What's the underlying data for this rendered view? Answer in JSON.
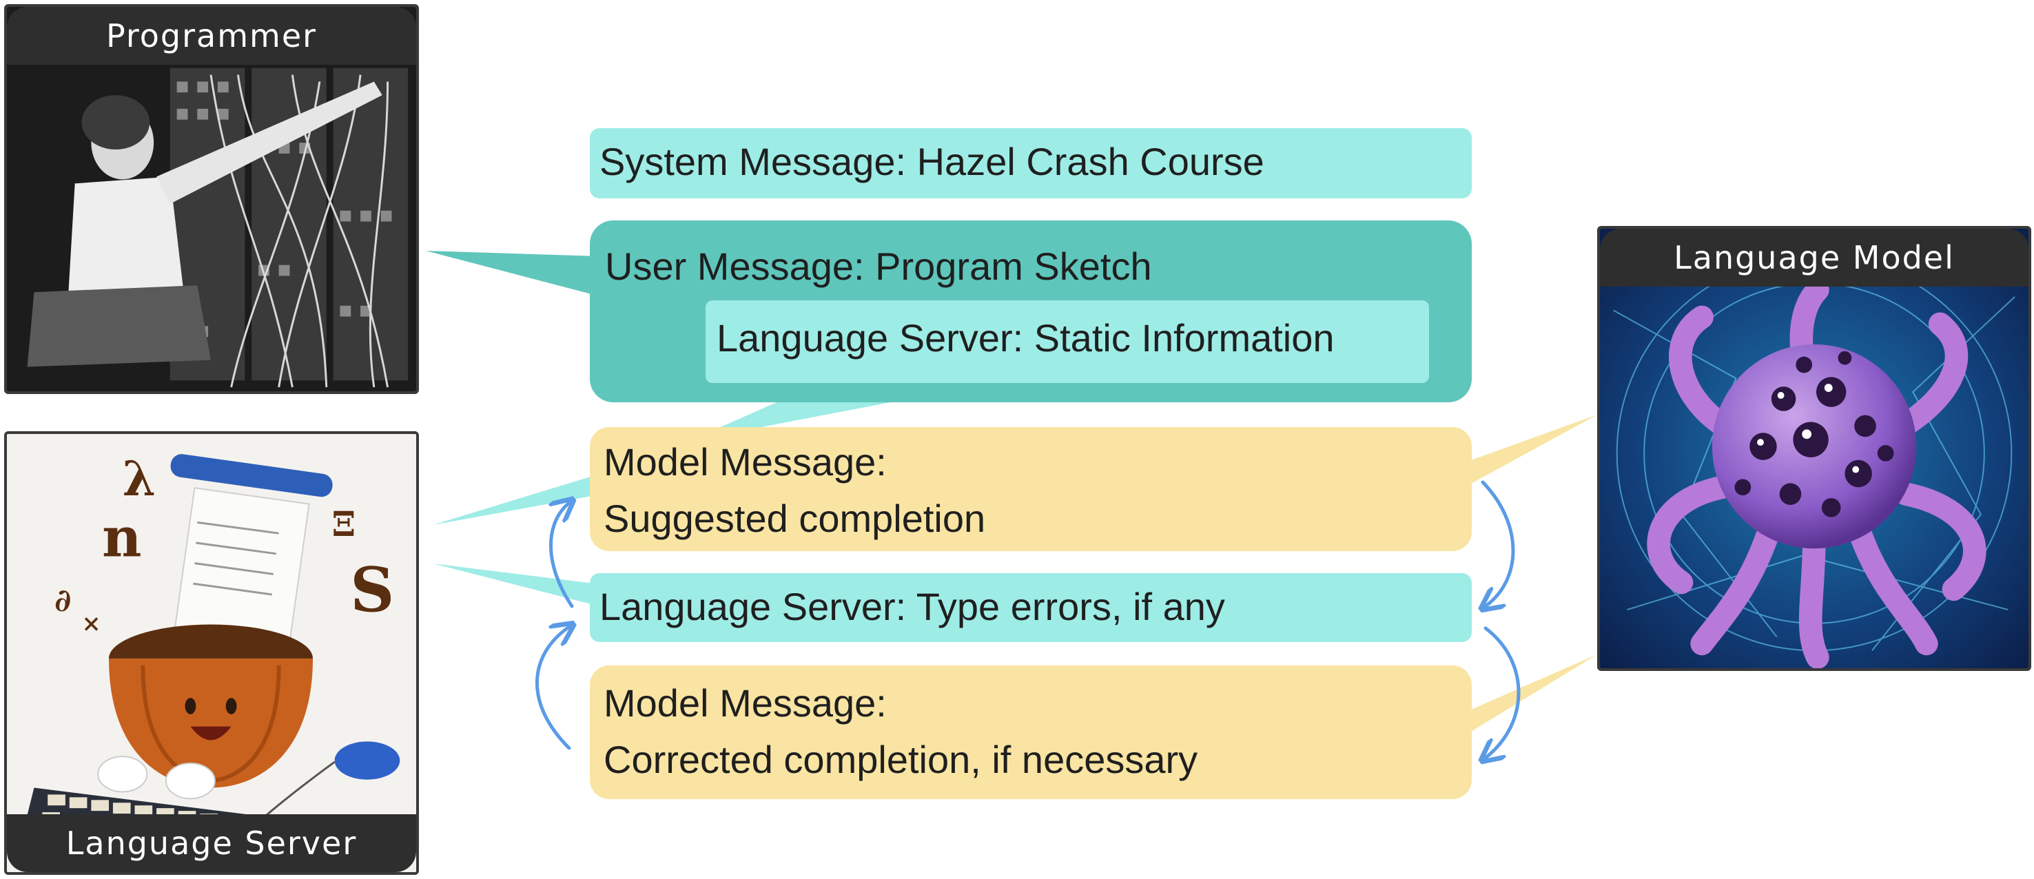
{
  "panels": {
    "programmer": {
      "label": "Programmer",
      "icon": "programmer-photo"
    },
    "language_server": {
      "label": "Language Server",
      "icon": "pumpkin-typing-mascot"
    },
    "language_model": {
      "label": "Language Model",
      "icon": "purple-octopus-sphere"
    }
  },
  "messages": {
    "system": "System Message: Hazel Crash Course",
    "user": "User Message: Program Sketch",
    "static_info": "Language Server: Static Information",
    "model_suggested_line1": "Model Message:",
    "model_suggested_line2": "Suggested completion",
    "type_errors": "Language Server: Type errors, if any",
    "model_corrected_line1": "Model Message:",
    "model_corrected_line2": "Corrected completion, if necessary"
  },
  "colors": {
    "cyan": "#9eece6",
    "teal": "#5fc6bc",
    "yellow": "#f9e4a3",
    "arrow_blue": "#5b9be6",
    "label_bg": "#2e2e2e"
  }
}
